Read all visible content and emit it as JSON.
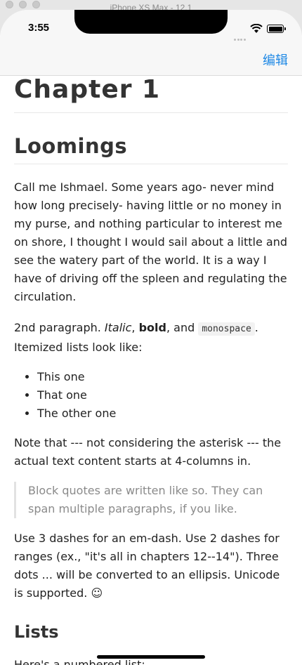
{
  "simulator": {
    "title": "iPhone XS Max - 12.1"
  },
  "status_bar": {
    "time": "3:55"
  },
  "navbar": {
    "edit_label": "编辑"
  },
  "doc": {
    "h1": "Chapter 1",
    "h2": "Loomings",
    "p1": "Call me Ishmael. Some years ago- never mind how long precisely- having little or no money in my purse, and nothing particular to interest me on shore, I thought I would sail about a little and see the watery part of the world. It is a way I have of driving off the spleen and regulating the circulation.",
    "p2": {
      "prefix": "2nd paragraph. ",
      "italic": "Italic",
      "comma": ", ",
      "bold": "bold",
      "and": ", and ",
      "mono": "monospace",
      "suffix": ". Itemized lists look like:"
    },
    "list": [
      "This one",
      "That one",
      "The other one"
    ],
    "p3": "Note that --- not considering the asterisk --- the actual text content starts at 4-columns in.",
    "blockquote": "Block quotes are written like so. They can span multiple paragraphs, if you like.",
    "p4": "Use 3 dashes for an em-dash. Use 2 dashes for ranges (ex., \"it's all in chapters 12--14\"). Three dots ... will be converted to an ellipsis. Unicode is supported. ☺",
    "h3": "Lists",
    "p5": "Here's a numbered list:"
  },
  "colors": {
    "accent": "#1e88e5"
  }
}
